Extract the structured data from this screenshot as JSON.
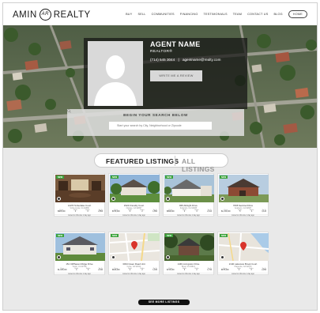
{
  "header": {
    "logo_left": "AMIN",
    "logo_mark": "AR",
    "logo_right": "REALTY",
    "nav": [
      "BUY",
      "SELL",
      "COMMUNITIES",
      "FINANCING",
      "TESTIMONIALS",
      "TEAM",
      "CONTACT US",
      "BLOG"
    ],
    "home_label": "HOME"
  },
  "agent": {
    "name": "AGENT NAME",
    "title": "REALTOR®",
    "phone": "(714) 545 3044",
    "separator": "|",
    "email": "agentname@realty.com",
    "review_label": "WRITE ME A REVIEW"
  },
  "search": {
    "title": "BEGIN YOUR SEARCH BELOW",
    "placeholder": "Start your search by City, Neighborhood or Zipcode"
  },
  "tabs": {
    "featured": "FEATURED LISTINGS",
    "all": "ALL LISTINGS"
  },
  "listings": [
    {
      "badge": "NEW",
      "address": "1425 Timberlake Court",
      "city": "Yorba Linda, CA 92886",
      "beds": "4",
      "baths": "3",
      "sqft": "2,856",
      "price": "$985,000",
      "listed": "Listed on this site 1 day ago"
    },
    {
      "badge": "NEW",
      "address": "1524 Friendly Court",
      "city": "Orange, CA 92867",
      "beds": "3",
      "baths": "2",
      "sqft": "1,850",
      "price": "$765,000",
      "listed": "Listed on this site 1 day ago"
    },
    {
      "badge": "NEW",
      "address": "845 Albright Drive",
      "city": "Fullerton, CA 92835",
      "beds": "4",
      "baths": "3",
      "sqft": "2,410",
      "price": "$899,000",
      "listed": "Listed on this site 1 day ago"
    },
    {
      "badge": "NEW",
      "address": "7065 Sentinel Drive",
      "city": "Anaheim, CA 92807",
      "beds": "5",
      "baths": "4",
      "sqft": "3,120",
      "price": "$1,150,000",
      "listed": "Listed on this site 1 day ago"
    },
    {
      "badge": "NEW",
      "address": "151 Cliffhaven Ridge Drive",
      "city": "Tustin, CA 92782",
      "beds": "4",
      "baths": "3",
      "sqft": "2,640",
      "price": "$1,025,000",
      "listed": "Listed on this site 1 day ago"
    },
    {
      "badge": "NEW",
      "address": "3034 Gwen Road Unit",
      "city": "Irvine, CA 92614",
      "beds": "2",
      "baths": "2",
      "sqft": "1,180",
      "price": "$629,000",
      "listed": "Listed on this site 1 day ago"
    },
    {
      "badge": "NEW",
      "address": "1449 Livingston Drive",
      "city": "Brea, CA 92821",
      "beds": "3",
      "baths": "2",
      "sqft": "1,740",
      "price": "$745,000",
      "listed": "Listed on this site 1 day ago"
    },
    {
      "badge": "NEW",
      "address": "2140 Lakeview Brook Court",
      "city": "Placentia, CA 92870",
      "beds": "4",
      "baths": "3",
      "sqft": "2,290",
      "price": "$875,000",
      "listed": "Listed on this site 1 day ago"
    }
  ],
  "stat_labels": {
    "price": "Price",
    "beds": "Beds",
    "baths": "Baths",
    "sqft": "Sq Ft"
  },
  "more_label": "SEE MORE LISTINGS",
  "colors": {
    "badge": "#3aa33a",
    "overlay": "#141414",
    "background": "#e9e9e9"
  }
}
